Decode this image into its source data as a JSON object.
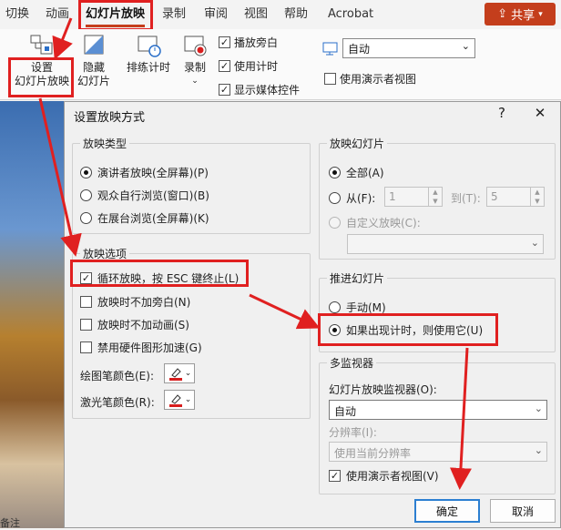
{
  "ribbon_tabs": [
    "切换",
    "动画",
    "幻灯片放映",
    "录制",
    "审阅",
    "视图",
    "帮助",
    "Acrobat"
  ],
  "share_label": "共享",
  "ribbon": {
    "setup_line1": "设置",
    "setup_line2": "幻灯片放映",
    "hide_line1": "隐藏",
    "hide_line2": "幻灯片",
    "rehearse": "排练计时",
    "record": "录制",
    "play_narration": "播放旁白",
    "use_timings": "使用计时",
    "show_media": "显示媒体控件",
    "monitor_value": "自动",
    "presenter_view": "使用演示者视图"
  },
  "dialog": {
    "title": "设置放映方式",
    "help": "?",
    "close": "✕",
    "show_type": {
      "title": "放映类型",
      "options": [
        "演讲者放映(全屏幕)(P)",
        "观众自行浏览(窗口)(B)",
        "在展台浏览(全屏幕)(K)"
      ]
    },
    "show_options": {
      "title": "放映选项",
      "loop": "循环放映，按 ESC 键终止(L)",
      "no_narration": "放映时不加旁白(N)",
      "no_animation": "放映时不加动画(S)",
      "disable_hw": "禁用硬件图形加速(G)",
      "pen_color": "绘图笔颜色(E):",
      "laser_color": "激光笔颜色(R):"
    },
    "show_slides": {
      "title": "放映幻灯片",
      "all": "全部(A)",
      "from": "从(F):",
      "from_value": "1",
      "to": "到(T):",
      "to_value": "5",
      "custom": "自定义放映(C):"
    },
    "advance": {
      "title": "推进幻灯片",
      "manual": "手动(M)",
      "timings": "如果出现计时，则使用它(U)"
    },
    "multi_monitor": {
      "title": "多监视器",
      "monitor_label": "幻灯片放映监视器(O):",
      "monitor_value": "自动",
      "resolution_label": "分辨率(I):",
      "resolution_value": "使用当前分辨率",
      "presenter_view": "使用演示者视图(V)"
    },
    "ok": "确定",
    "cancel": "取消"
  },
  "status_text": "备注",
  "colors": {
    "accent": "#c43e1c",
    "annotation_red": "#e02020",
    "ok_border": "#2c7fd1",
    "pen_red": "#d81e1e"
  },
  "icons": [
    "setup-slideshow-icon",
    "hide-slide-icon",
    "rehearse-timings-icon",
    "record-icon",
    "monitor-icon",
    "pen-icon"
  ]
}
